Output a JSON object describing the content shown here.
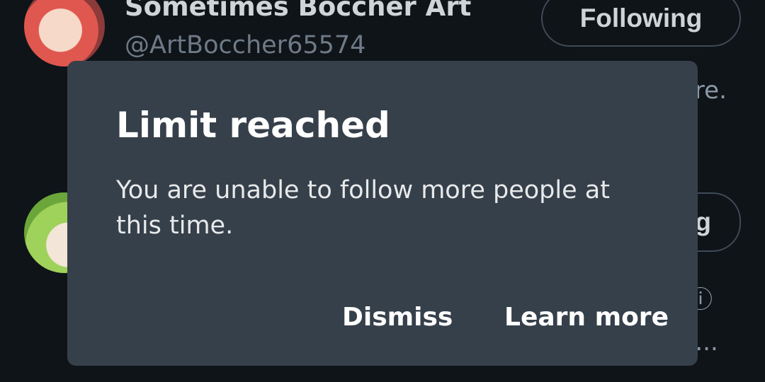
{
  "background_list": {
    "users": [
      {
        "display_name": "Sometimes Boccher Art",
        "handle": "@ArtBoccher65574",
        "follow_label": "Following",
        "bio_fragment": "ere."
      },
      {
        "follow_label": "g",
        "bio_fragment_1": "ⓘ",
        "bio_fragment_2": "t..."
      }
    ]
  },
  "dialog": {
    "title": "Limit reached",
    "message": "You are unable to follow more people at this time.",
    "dismiss_label": "Dismiss",
    "learn_more_label": "Learn more"
  },
  "colors": {
    "background": "#0f1419",
    "dialog_background": "#36404a",
    "primary_text": "#ffffff",
    "secondary_text": "#8b98a5"
  }
}
